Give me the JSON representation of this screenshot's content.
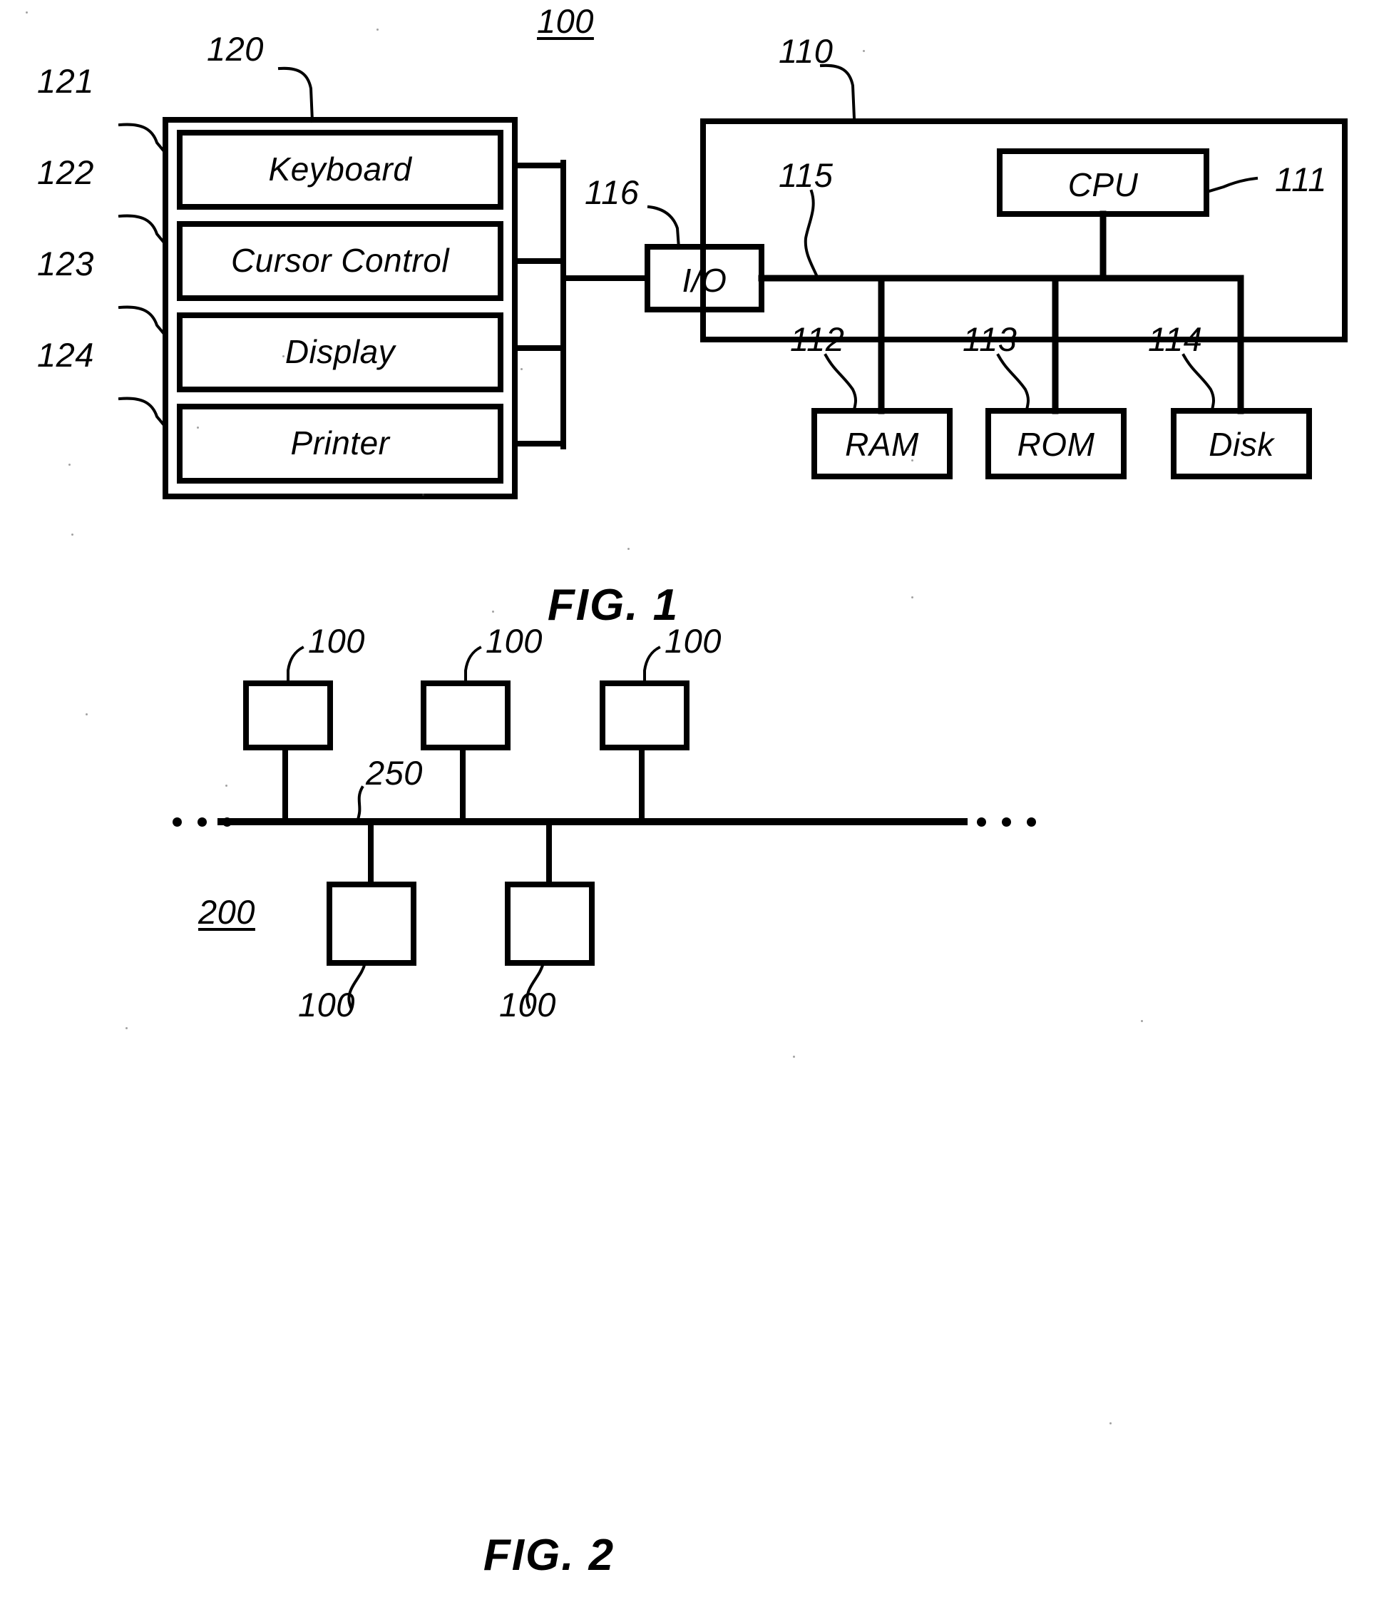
{
  "document": {
    "kind": "patent-drawing-sheet",
    "figures": [
      "FIG. 1",
      "FIG. 2"
    ]
  },
  "fig1": {
    "caption": "FIG. 1",
    "system_ref": "100",
    "peripheral_group": {
      "ref": "120",
      "items": [
        {
          "ref": "121",
          "label": "Keyboard"
        },
        {
          "ref": "122",
          "label": "Cursor  Control"
        },
        {
          "ref": "123",
          "label": "Display"
        },
        {
          "ref": "124",
          "label": "Printer"
        }
      ]
    },
    "io": {
      "ref": "116",
      "label": "I/O"
    },
    "computer": {
      "ref": "110",
      "bus_ref": "115",
      "components": [
        {
          "ref": "111",
          "label": "CPU"
        },
        {
          "ref": "112",
          "label": "RAM"
        },
        {
          "ref": "113",
          "label": "ROM"
        },
        {
          "ref": "114",
          "label": "Disk"
        }
      ]
    }
  },
  "fig2": {
    "caption": "FIG. 2",
    "network_ref": "200",
    "bus_ref": "250",
    "node_refs_top": [
      "100",
      "100",
      "100"
    ],
    "node_refs_bottom": [
      "100",
      "100"
    ],
    "ellipsis_left": "...",
    "ellipsis_right": "..."
  }
}
